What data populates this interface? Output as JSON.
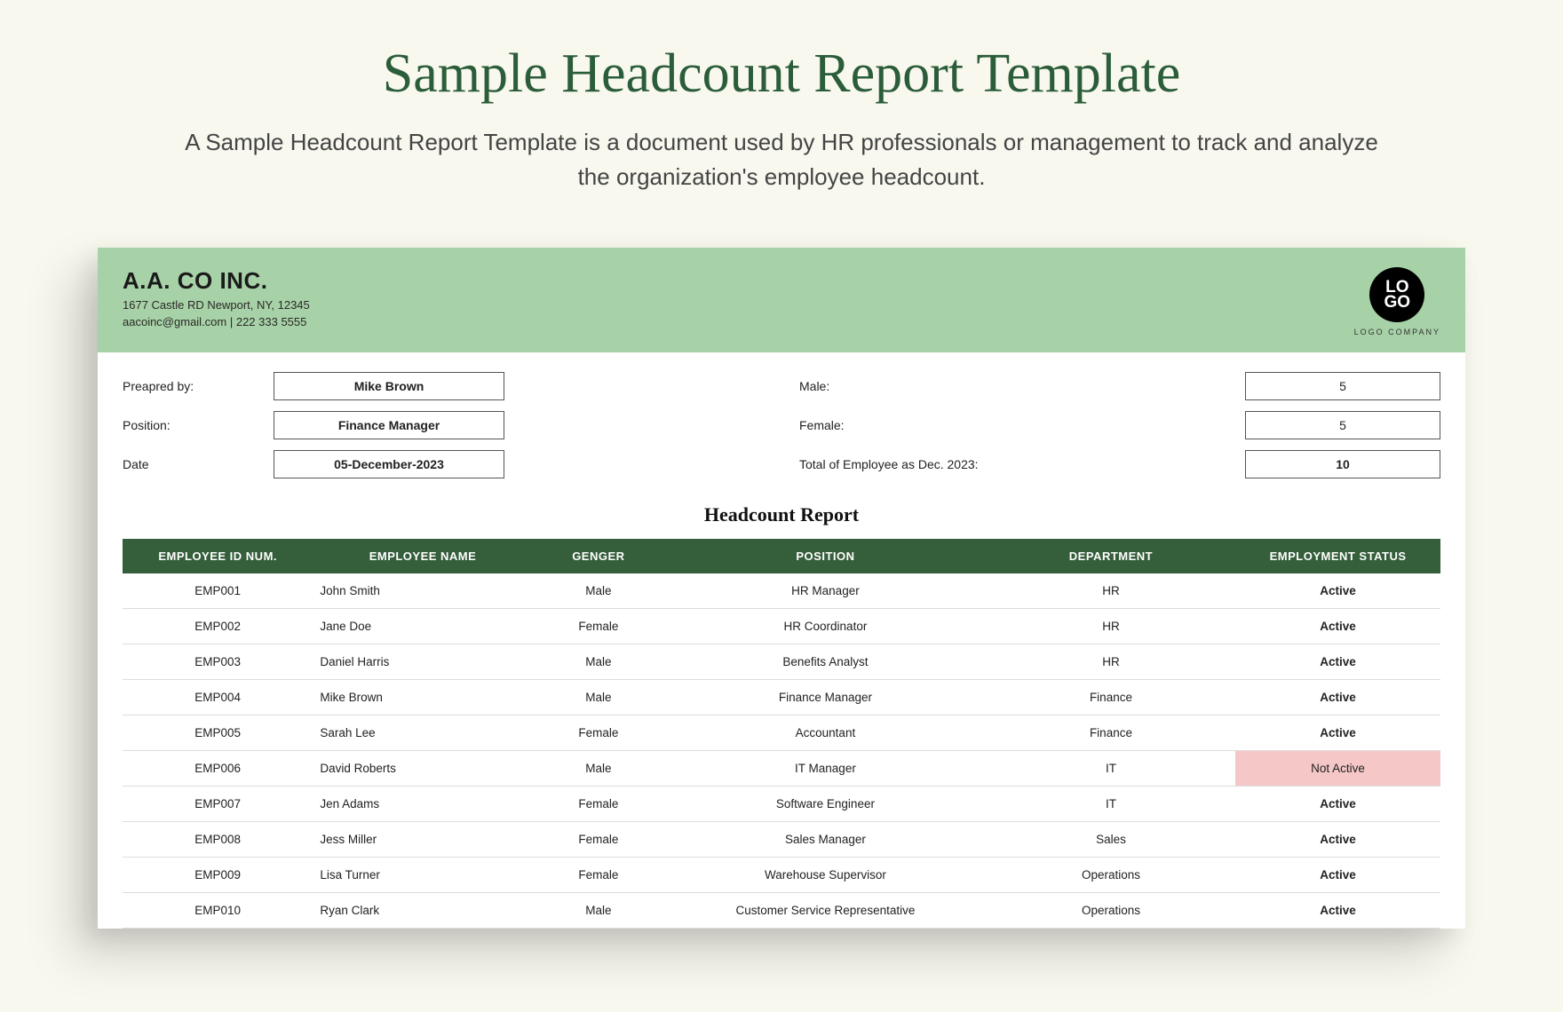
{
  "page": {
    "title": "Sample Headcount Report Template",
    "description": "A Sample Headcount Report Template is a document used by HR professionals or management to track and analyze the organization's employee headcount."
  },
  "header": {
    "company_name": "A.A. CO INC.",
    "address": "1677 Castle RD Newport, NY, 12345",
    "contact": "aacoinc@gmail.com | 222 333 5555",
    "logo_top": "LO",
    "logo_bottom": "GO",
    "logo_caption": "LOGO COMPANY"
  },
  "meta": {
    "left": [
      {
        "label": "Preapred by:",
        "value": "Mike Brown"
      },
      {
        "label": "Position:",
        "value": "Finance Manager"
      },
      {
        "label": "Date",
        "value": "05-December-2023"
      }
    ],
    "right": [
      {
        "label": "Male:",
        "value": "5"
      },
      {
        "label": "Female:",
        "value": "5"
      },
      {
        "label": "Total of Employee as Dec. 2023:",
        "value": "10",
        "total": true
      }
    ]
  },
  "report_title": "Headcount Report",
  "table": {
    "headers": [
      "EMPLOYEE ID NUM.",
      "EMPLOYEE NAME",
      "GENGER",
      "POSITION",
      "DEPARTMENT",
      "EMPLOYMENT STATUS"
    ],
    "rows": [
      {
        "id": "EMP001",
        "name": "John Smith",
        "gender": "Male",
        "position": "HR Manager",
        "department": "HR",
        "status": "Active",
        "active": true
      },
      {
        "id": "EMP002",
        "name": "Jane Doe",
        "gender": "Female",
        "position": "HR Coordinator",
        "department": "HR",
        "status": "Active",
        "active": true
      },
      {
        "id": "EMP003",
        "name": "Daniel Harris",
        "gender": "Male",
        "position": "Benefits Analyst",
        "department": "HR",
        "status": "Active",
        "active": true
      },
      {
        "id": "EMP004",
        "name": "Mike Brown",
        "gender": "Male",
        "position": "Finance Manager",
        "department": "Finance",
        "status": "Active",
        "active": true
      },
      {
        "id": "EMP005",
        "name": "Sarah Lee",
        "gender": "Female",
        "position": "Accountant",
        "department": "Finance",
        "status": "Active",
        "active": true
      },
      {
        "id": "EMP006",
        "name": "David Roberts",
        "gender": "Male",
        "position": "IT Manager",
        "department": "IT",
        "status": "Not Active",
        "active": false
      },
      {
        "id": "EMP007",
        "name": "Jen Adams",
        "gender": "Female",
        "position": "Software Engineer",
        "department": "IT",
        "status": "Active",
        "active": true
      },
      {
        "id": "EMP008",
        "name": "Jess Miller",
        "gender": "Female",
        "position": "Sales Manager",
        "department": "Sales",
        "status": "Active",
        "active": true
      },
      {
        "id": "EMP009",
        "name": "Lisa Turner",
        "gender": "Female",
        "position": "Warehouse Supervisor",
        "department": "Operations",
        "status": "Active",
        "active": true
      },
      {
        "id": "EMP010",
        "name": "Ryan Clark",
        "gender": "Male",
        "position": "Customer Service Representative",
        "department": "Operations",
        "status": "Active",
        "active": true
      }
    ]
  }
}
